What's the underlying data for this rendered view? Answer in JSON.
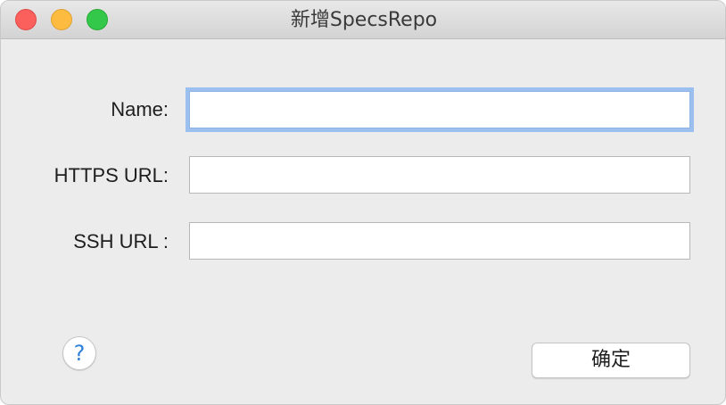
{
  "window": {
    "title": "新增SpecsRepo",
    "controls": [
      "close-icon",
      "minimize-icon",
      "zoom-icon"
    ]
  },
  "form": {
    "name_label": "Name:",
    "name_value": "",
    "https_label": "HTTPS URL:",
    "https_value": "",
    "ssh_label": "SSH URL :",
    "ssh_value": ""
  },
  "footer": {
    "help_label": "?",
    "confirm_label": "确定"
  },
  "colors": {
    "background": "#ececec",
    "focus_ring": "#9bbfee",
    "help_glyph": "#2e7fd8",
    "close": "#fc605c",
    "minimize": "#fdbc40",
    "zoom": "#34c84a"
  }
}
